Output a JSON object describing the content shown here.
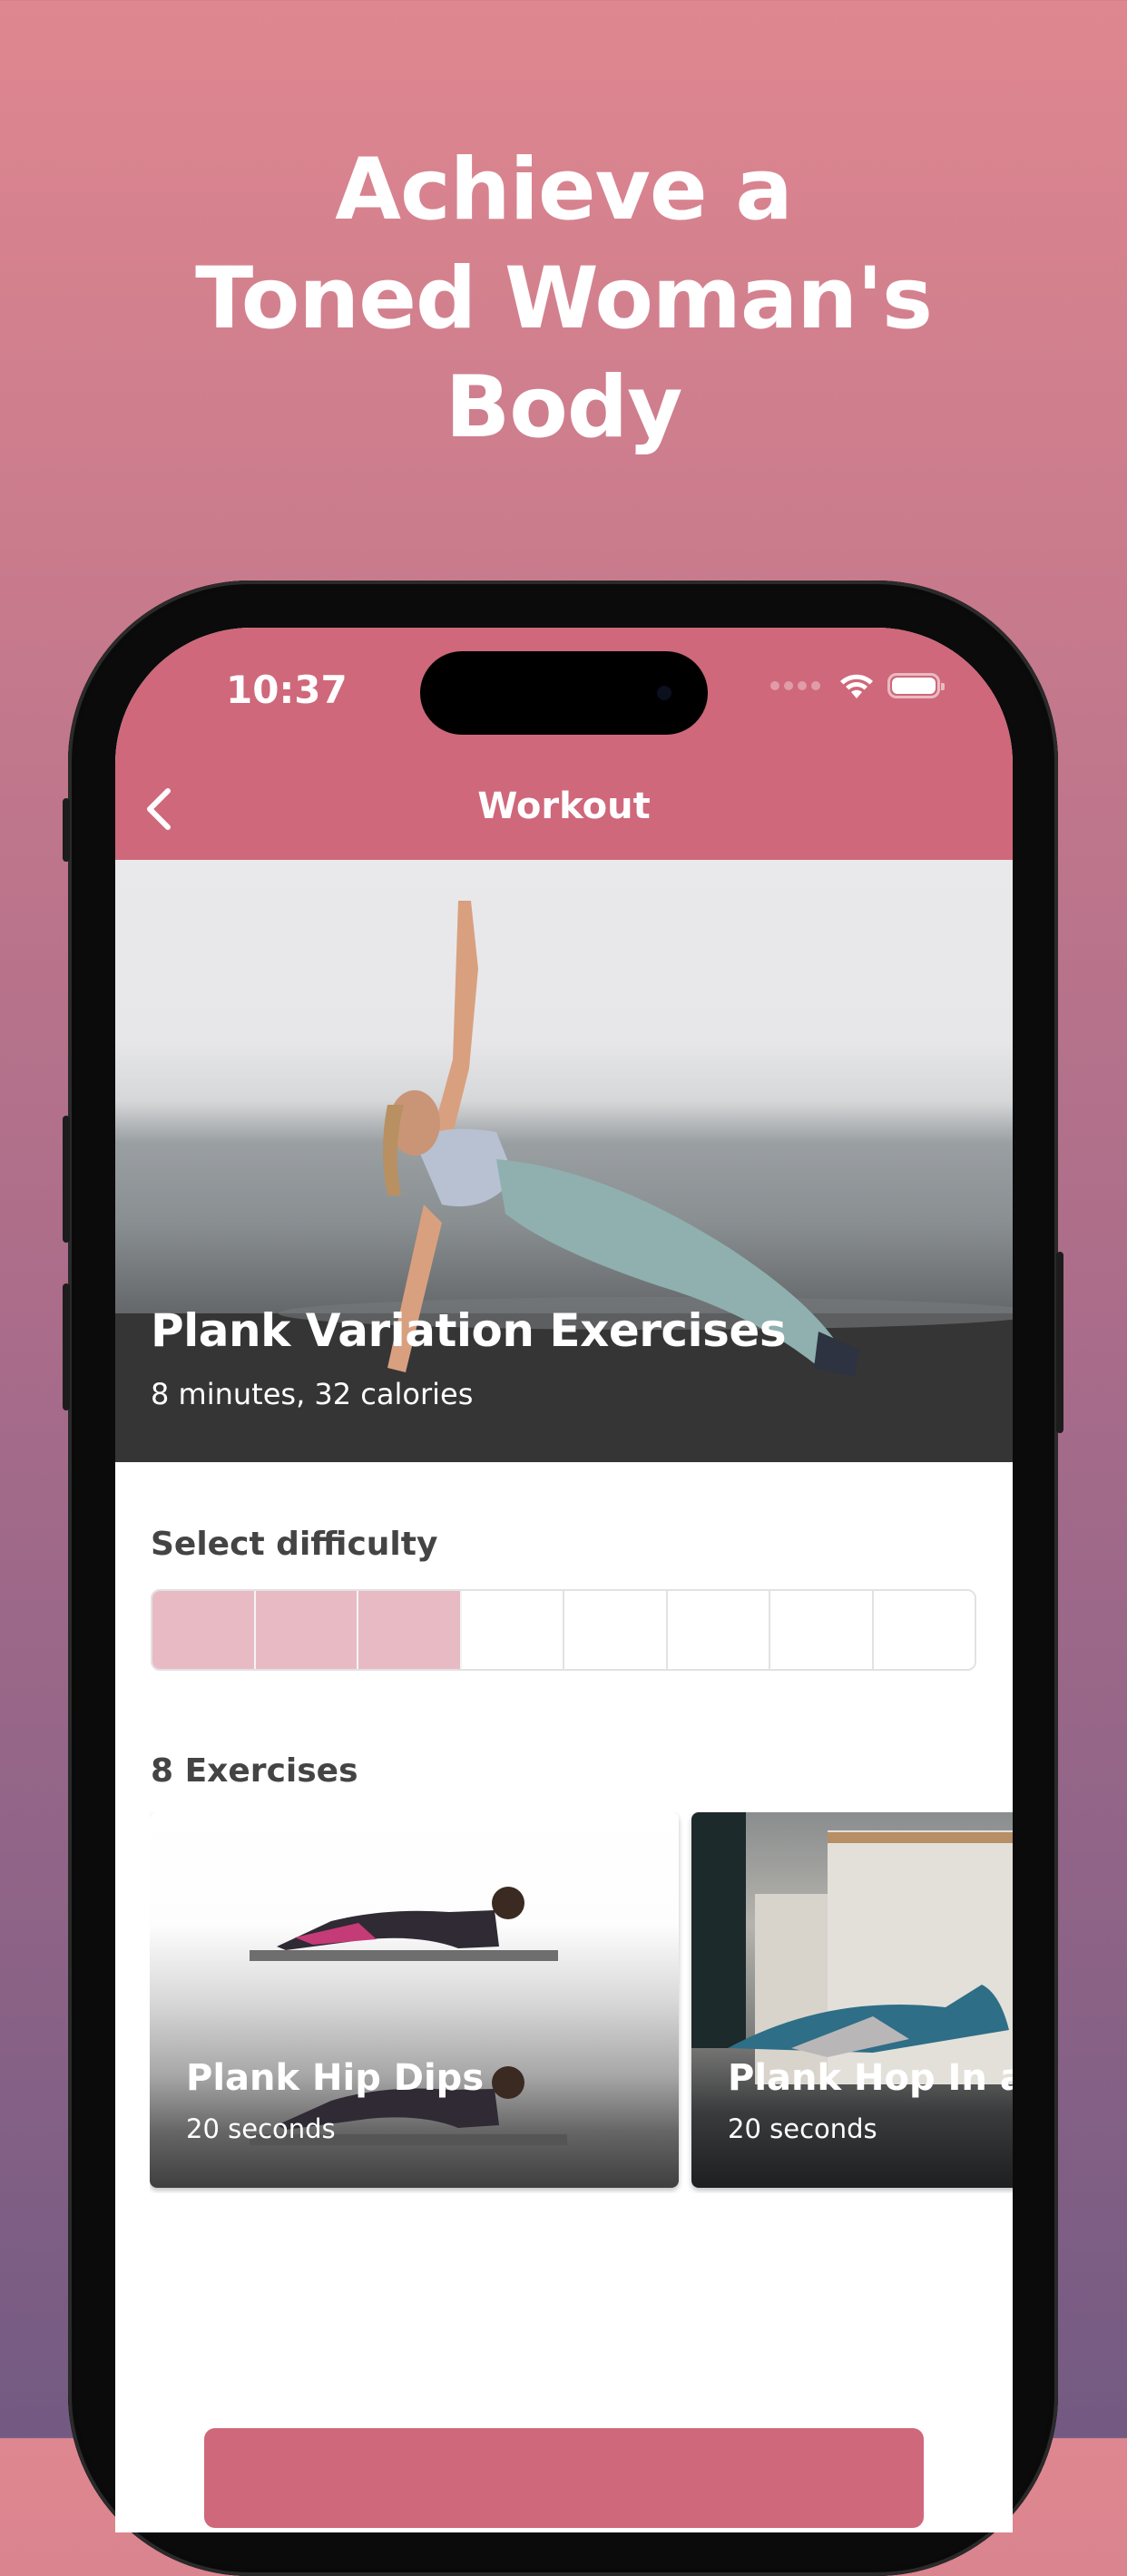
{
  "promo": {
    "headline_lines": [
      "Achieve a",
      "Toned Woman's",
      "Body"
    ]
  },
  "status_bar": {
    "time": "10:37",
    "icons": [
      "signal-icon",
      "wifi-icon",
      "battery-icon"
    ]
  },
  "nav": {
    "title": "Workout",
    "back_icon": "chevron-left-icon"
  },
  "colors": {
    "accent": "#cf687a",
    "difficulty_selected": "#e8bbc4",
    "difficulty_unselected": "#ffffff",
    "label_text": "#444444"
  },
  "hero": {
    "title": "Plank Variation Exercises",
    "subtitle": "8 minutes, 32 calories"
  },
  "difficulty": {
    "label": "Select difficulty",
    "selected_level": 3,
    "total_levels": 8
  },
  "exercises": {
    "count_label": "8 Exercises",
    "items": [
      {
        "title": "Plank Hip Dips",
        "duration": "20 seconds"
      },
      {
        "title": "Plank Hop In and Out",
        "duration": "20 seconds"
      }
    ]
  },
  "start_button": {
    "label": ""
  }
}
